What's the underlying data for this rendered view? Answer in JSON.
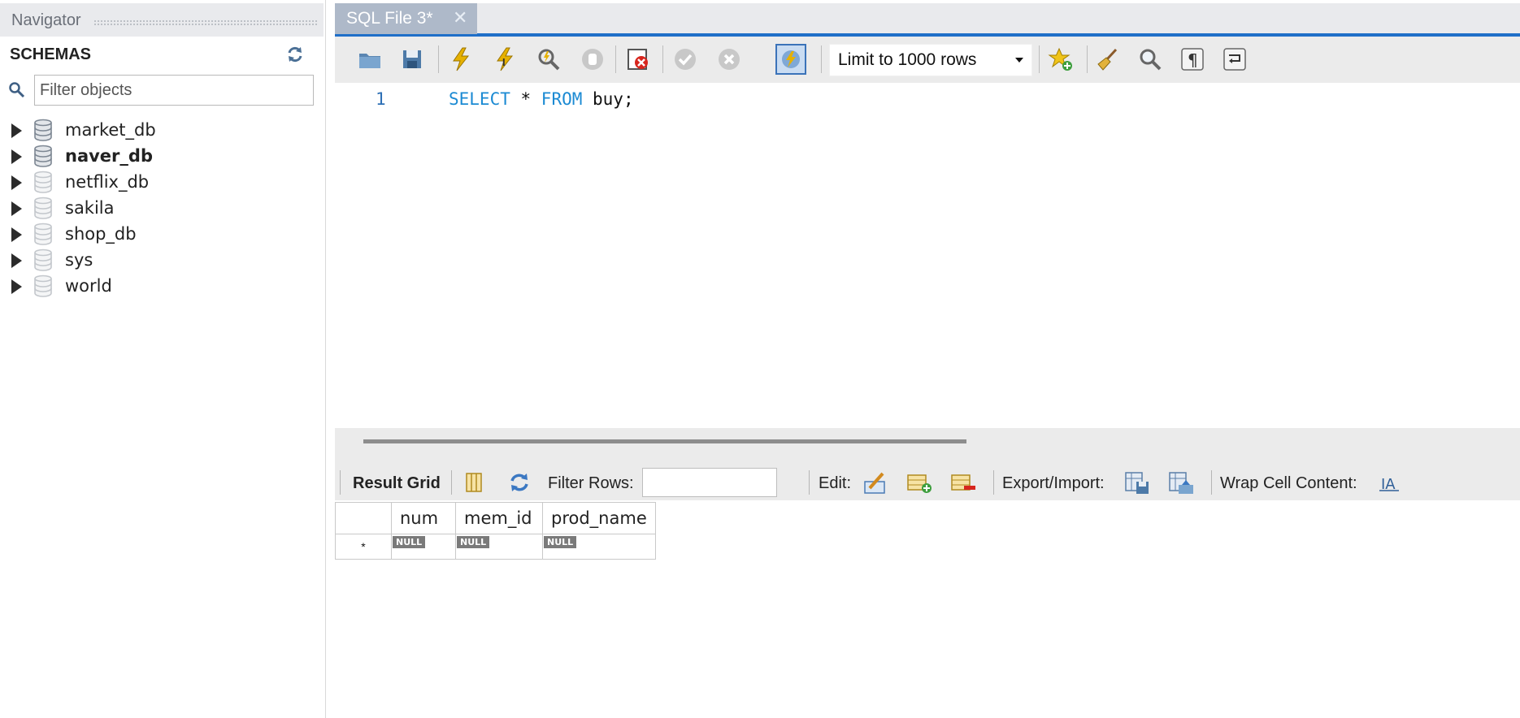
{
  "navigator": {
    "title": "Navigator",
    "schemas_label": "SCHEMAS",
    "filter_placeholder": "Filter objects",
    "schemas": [
      {
        "name": "market_db",
        "bold": false,
        "active": true
      },
      {
        "name": "naver_db",
        "bold": true,
        "active": true
      },
      {
        "name": "netflix_db",
        "bold": false,
        "active": false
      },
      {
        "name": "sakila",
        "bold": false,
        "active": false
      },
      {
        "name": "shop_db",
        "bold": false,
        "active": false
      },
      {
        "name": "sys",
        "bold": false,
        "active": false
      },
      {
        "name": "world",
        "bold": false,
        "active": false
      }
    ]
  },
  "editor": {
    "tab_label": "SQL File 3*",
    "limit_label": "Limit to 1000 rows",
    "line_number": "1",
    "code_tokens": [
      {
        "text": "SELECT",
        "kind": "keyword"
      },
      {
        "text": " * ",
        "kind": "plain"
      },
      {
        "text": "FROM",
        "kind": "keyword"
      },
      {
        "text": " buy;",
        "kind": "plain"
      }
    ],
    "toolbar_icons": [
      "open-folder-icon",
      "save-icon",
      "execute-icon",
      "execute-current-icon",
      "explain-icon",
      "stop-icon",
      "toggle-error-icon",
      "commit-icon",
      "rollback-icon",
      "autocommit-icon",
      "add-snippet-icon",
      "beautify-icon",
      "find-icon",
      "invisible-chars-icon",
      "wrap-lines-icon"
    ]
  },
  "result": {
    "grid_label": "Result Grid",
    "filter_rows_label": "Filter Rows:",
    "edit_label": "Edit:",
    "export_label": "Export/Import:",
    "wrap_label": "Wrap Cell Content:",
    "columns": [
      "num",
      "mem_id",
      "prod_name"
    ],
    "null_label": "NULL",
    "new_row_marker": "*"
  },
  "colors": {
    "accent": "#1f6fc8",
    "keyword": "#1b8ad3",
    "tab_bg": "#aeb9c9"
  }
}
